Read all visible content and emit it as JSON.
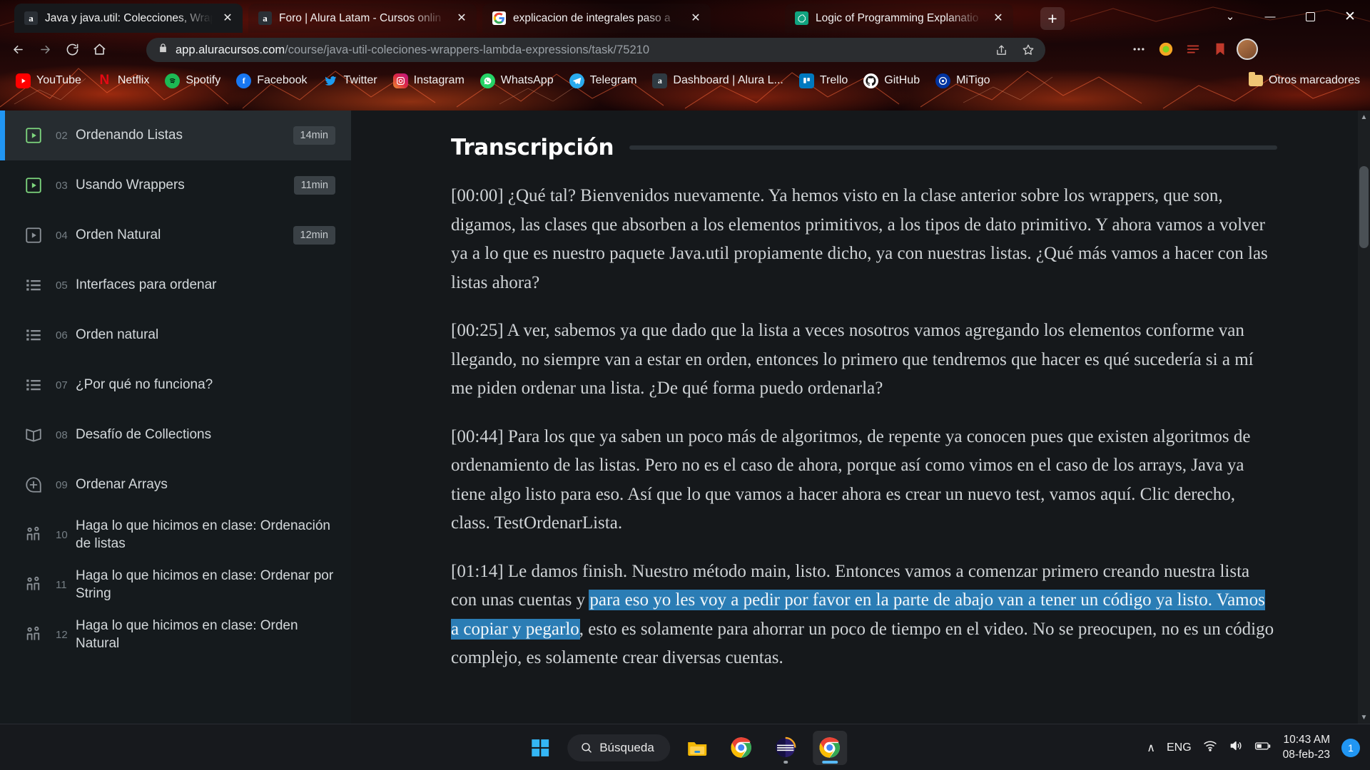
{
  "browser": {
    "tabs": [
      {
        "title": "Java y java.util: Colecciones, Wrap",
        "favicon": "alura-icon",
        "active": true
      },
      {
        "title": "Foro | Alura Latam - Cursos onlin",
        "favicon": "alura-icon",
        "active": false
      },
      {
        "title": "explicacion de integrales paso a",
        "favicon": "google-icon",
        "active": false
      },
      {
        "title": "Logic of Programming Explanatio",
        "favicon": "openai-icon",
        "active": false
      }
    ],
    "new_tab_label": "+",
    "window_controls": {
      "minimize": "—",
      "maximize": "❐",
      "close": "✕",
      "more": "⌄"
    },
    "omnibox": {
      "domain": "app.aluracursos.com",
      "path": "/course/java-util-coleciones-wrappers-lambda-expressions/task/75210",
      "lock_icon": "lock-icon",
      "share_icon": "share-icon",
      "star_icon": "star-icon"
    },
    "bookmarks": [
      {
        "label": "YouTube",
        "icon": "youtube-icon",
        "color": "#ff0000"
      },
      {
        "label": "Netflix",
        "icon": "netflix-icon",
        "color": "#e50914"
      },
      {
        "label": "Spotify",
        "icon": "spotify-icon",
        "color": "#1db954"
      },
      {
        "label": "Facebook",
        "icon": "facebook-icon",
        "color": "#1877f2"
      },
      {
        "label": "Twitter",
        "icon": "twitter-icon",
        "color": "#1d9bf0"
      },
      {
        "label": "Instagram",
        "icon": "instagram-icon",
        "color": "#c13584"
      },
      {
        "label": "WhatsApp",
        "icon": "whatsapp-icon",
        "color": "#25d366"
      },
      {
        "label": "Telegram",
        "icon": "telegram-icon",
        "color": "#2aabee"
      },
      {
        "label": "Dashboard | Alura L...",
        "icon": "alura-icon",
        "color": "#2f3a42"
      },
      {
        "label": "Trello",
        "icon": "trello-icon",
        "color": "#0079bf"
      },
      {
        "label": "GitHub",
        "icon": "github-icon",
        "color": "#171515"
      },
      {
        "label": "MiTigo",
        "icon": "mitigo-icon",
        "color": "#0033a0"
      }
    ],
    "other_bookmarks_label": "Otros marcadores"
  },
  "sidebar": {
    "items": [
      {
        "num": "02",
        "label": "Ordenando Listas",
        "duration": "14min",
        "icon": "play-icon",
        "state": "done",
        "active": true
      },
      {
        "num": "03",
        "label": "Usando Wrappers",
        "duration": "11min",
        "icon": "play-icon",
        "state": "done",
        "active": false
      },
      {
        "num": "04",
        "label": "Orden Natural",
        "duration": "12min",
        "icon": "play-icon",
        "state": "todo",
        "active": false
      },
      {
        "num": "05",
        "label": "Interfaces para ordenar",
        "duration": "",
        "icon": "list-icon",
        "state": "todo",
        "active": false
      },
      {
        "num": "06",
        "label": "Orden natural",
        "duration": "",
        "icon": "list-icon",
        "state": "todo",
        "active": false
      },
      {
        "num": "07",
        "label": "¿Por qué no funciona?",
        "duration": "",
        "icon": "list-icon",
        "state": "todo",
        "active": false
      },
      {
        "num": "08",
        "label": "Desafío de Collections",
        "duration": "",
        "icon": "book-icon",
        "state": "todo",
        "active": false
      },
      {
        "num": "09",
        "label": "Ordenar Arrays",
        "duration": "",
        "icon": "plus-circle-icon",
        "state": "todo",
        "active": false
      },
      {
        "num": "10",
        "label": "Haga lo que hicimos en clase: Ordenación de listas",
        "duration": "",
        "icon": "people-icon",
        "state": "todo",
        "active": false
      },
      {
        "num": "11",
        "label": "Haga lo que hicimos en clase: Ordenar por String",
        "duration": "",
        "icon": "people-icon",
        "state": "todo",
        "active": false
      },
      {
        "num": "12",
        "label": "Haga lo que hicimos en clase: Orden Natural",
        "duration": "",
        "icon": "people-icon",
        "state": "todo",
        "active": false
      }
    ]
  },
  "transcript": {
    "title": "Transcripción",
    "paragraphs": [
      {
        "text": "[00:00] ¿Qué tal? Bienvenidos nuevamente. Ya hemos visto en la clase anterior sobre los wrappers, que son, digamos, las clases que absorben a los elementos primitivos, a los tipos de dato primitivo. Y ahora vamos a volver ya a lo que es nuestro paquete Java.util propiamente dicho, ya con nuestras listas. ¿Qué más vamos a hacer con las listas ahora?"
      },
      {
        "text": "[00:25] A ver, sabemos ya que dado que la lista a veces nosotros vamos agregando los elementos conforme van llegando, no siempre van a estar en orden, entonces lo primero que tendremos que hacer es qué sucedería si a mí me piden ordenar una lista. ¿De qué forma puedo ordenarla?"
      },
      {
        "text": "[00:44] Para los que ya saben un poco más de algoritmos, de repente ya conocen pues que existen algoritmos de ordenamiento de las listas. Pero no es el caso de ahora, porque así como vimos en el caso de los arrays, Java ya tiene algo listo para eso. Así que lo que vamos a hacer ahora es crear un nuevo test, vamos aquí. Clic derecho, class. TestOrdenarLista."
      }
    ],
    "selected_paragraph": {
      "before": "[01:14] Le damos finish. Nuestro método main, listo. Entonces vamos a comenzar primero creando nuestra lista con unas cuentas y ",
      "highlighted": "para eso yo les voy a pedir por favor en la parte de abajo van a tener un código ya listo. Vamos a copiar y pegarlo",
      "after": ", esto es solamente para ahorrar un poco de tiempo en el video. No se preocupen, no es un código complejo, es solamente crear diversas cuentas."
    },
    "highlight_color": "#2b7db5"
  },
  "taskbar": {
    "start_label": "start-button",
    "search_placeholder": "Búsqueda",
    "apps": [
      {
        "name": "file-explorer",
        "running": false
      },
      {
        "name": "google-chrome",
        "running": false
      },
      {
        "name": "alura-app",
        "running": true
      },
      {
        "name": "google-chrome-active",
        "running": true
      }
    ],
    "tray": {
      "chevron": "∧",
      "language": "ENG",
      "wifi_icon": "wifi-icon",
      "volume_icon": "volume-icon",
      "battery_icon": "battery-icon",
      "time": "10:43 AM",
      "date": "08-feb-23",
      "notification_count": "1"
    }
  }
}
